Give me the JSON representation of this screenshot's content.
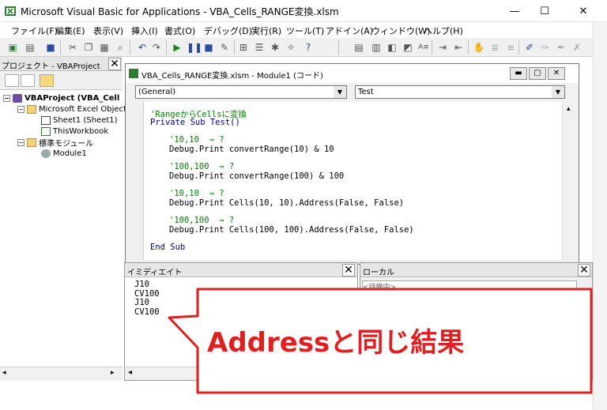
{
  "window": {
    "title": "Microsoft Visual Basic for Applications - VBA_Cells_RANGE変換.xlsm",
    "minimize": "—",
    "maximize": "☐",
    "close": "✕"
  },
  "menu": [
    "ファイル(F)",
    "編集(E)",
    "表示(V)",
    "挿入(I)",
    "書式(O)",
    "デバッグ(D)",
    "実行(R)",
    "ツール(T)",
    "アドイン(A)",
    "ウィンドウ(W)",
    "ヘルプ(H)"
  ],
  "project": {
    "title": "プロジェクト - VBAProject",
    "close": "✕",
    "tree": {
      "root": "VBAProject (VBA_Cell",
      "excel_objects": "Microsoft Excel Object",
      "sheet1": "Sheet1 (Sheet1)",
      "thisworkbook": "ThisWorkbook",
      "modules": "標準モジュール",
      "module1": "Module1"
    }
  },
  "code": {
    "title": "VBA_Cells_RANGE変換.xlsm - Module1 (コード)",
    "object_combo": "(General)",
    "proc_combo": "Test",
    "lines": [
      {
        "text": "'RangeからCellsに変換",
        "kind": "comment",
        "indent": 0
      },
      {
        "text": "Private Sub Test()",
        "kind": "keyword",
        "indent": 0
      },
      {
        "text": "'10,10  ⇒ ?",
        "kind": "comment",
        "indent": 1
      },
      {
        "text": "Debug.Print convertRange(10) & 10",
        "kind": "text",
        "indent": 1
      },
      {
        "text": "'100,100  ⇒ ?",
        "kind": "comment",
        "indent": 1
      },
      {
        "text": "Debug.Print convertRange(100) & 100",
        "kind": "text",
        "indent": 1
      },
      {
        "text": "'10,10  ⇒ ?",
        "kind": "comment",
        "indent": 1
      },
      {
        "text": "Debug.Print Cells(10, 10).Address(False, False)",
        "kind": "text",
        "indent": 1
      },
      {
        "text": "'100,100  ⇒ ?",
        "kind": "comment",
        "indent": 1
      },
      {
        "text": "Debug.Print Cells(100, 100).Address(False, False)",
        "kind": "text",
        "indent": 1
      },
      {
        "text": "End Sub",
        "kind": "keyword",
        "indent": 0
      }
    ]
  },
  "immediate": {
    "title": "イミディエイト",
    "close": "✕",
    "lines": [
      "J10",
      "CV100",
      "J10",
      "CV100"
    ]
  },
  "locals": {
    "title": "ローカル",
    "close": "✕",
    "field": "<待機中>"
  },
  "callout": {
    "text": "Addressと同じ結果"
  },
  "colors": {
    "comment": "#008000",
    "keyword": "#000080",
    "callout_border": "#e02020",
    "callout_text": "#e02020"
  }
}
